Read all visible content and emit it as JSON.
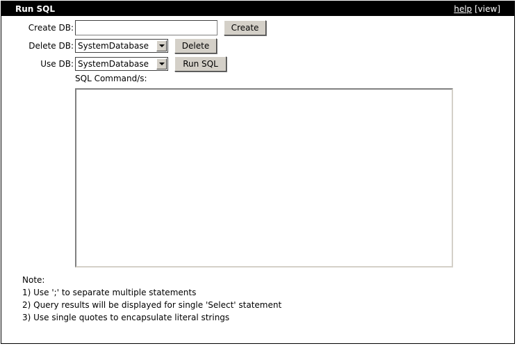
{
  "header": {
    "title": "Run SQL",
    "help_link": "help",
    "view_link": "[view]"
  },
  "create_db": {
    "label": "Create DB:",
    "value": "",
    "button": "Create"
  },
  "delete_db": {
    "label": "Delete DB:",
    "selected": "SystemDatabase",
    "button": "Delete"
  },
  "use_db": {
    "label": "Use DB:",
    "selected": "SystemDatabase",
    "button": "Run SQL"
  },
  "sql": {
    "label": "SQL Command/s:",
    "value": ""
  },
  "notes": {
    "heading": "Note:",
    "items": [
      "1) Use ';' to separate multiple statements",
      "2) Query results will be displayed for single 'Select' statement",
      "3) Use single quotes to encapsulate literal strings"
    ]
  },
  "colors": {
    "titlebar": "#000000",
    "button_face": "#d4d0c8"
  }
}
